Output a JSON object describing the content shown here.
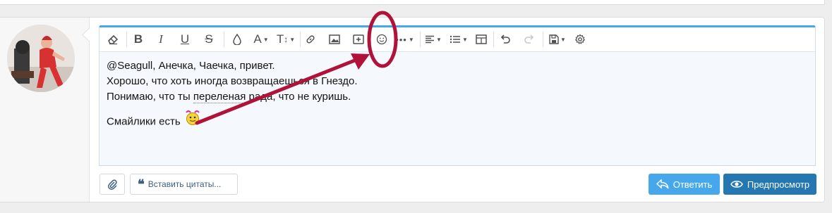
{
  "editor": {
    "content": {
      "line1": "@Seagull, Анечка, Чаечка, привет.",
      "line2": "Хорошо, что хоть иногда возвращаешься в Гнездо.",
      "line3_before": "Понимаю, что ты ",
      "line3_misspelled": "переленая",
      "line3_after": " рада, что не куришь.",
      "line4": "Смайлики есть"
    },
    "toolbar_icons": [
      "eraser-icon",
      "bold-icon",
      "italic-icon",
      "underline-icon",
      "strikethrough-icon",
      "text-color-icon",
      "font-family-icon",
      "font-size-icon",
      "link-icon",
      "image-icon",
      "media-icon",
      "smilie-icon",
      "more-options-icon",
      "align-icon",
      "list-icon",
      "table-icon",
      "undo-icon",
      "redo-icon",
      "drafts-icon",
      "settings-icon"
    ]
  },
  "footer": {
    "attach_icon": "paperclip-icon",
    "quote_label": "Вставить цитаты...",
    "reply_label": "Ответить",
    "preview_label": "Предпросмотр"
  },
  "colors": {
    "accent": "#47a7eb",
    "reply_button": "#47a7eb",
    "preview_button": "#2577b1",
    "annotation": "#b0123a"
  }
}
